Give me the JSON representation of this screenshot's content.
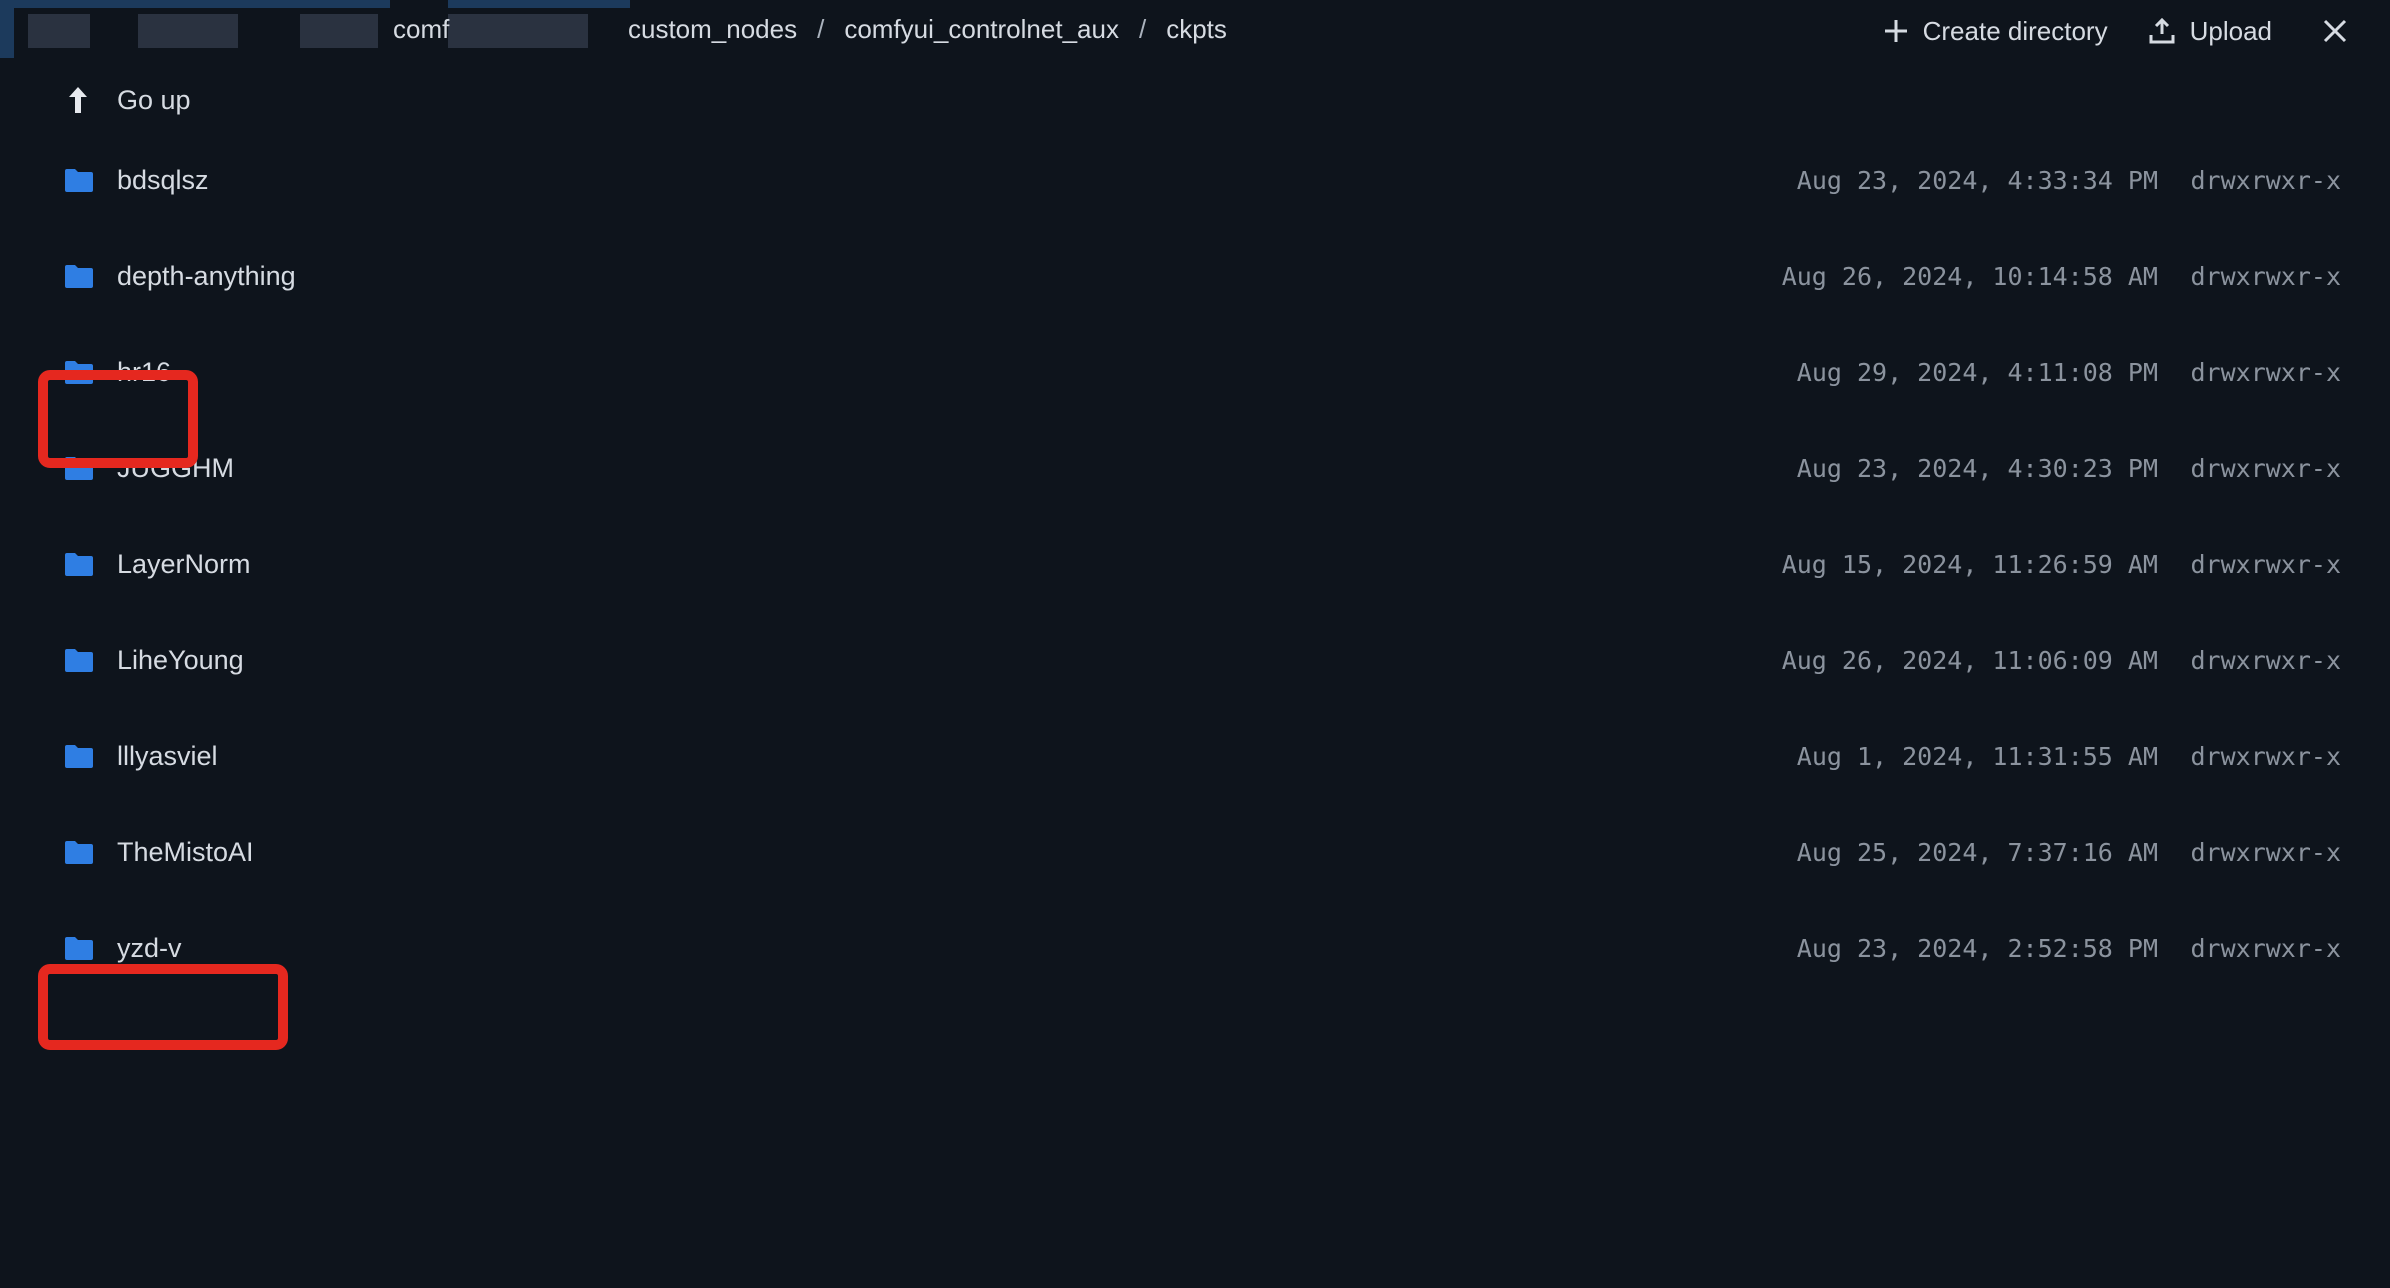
{
  "breadcrumb": {
    "partial_first": "comf",
    "items": [
      "custom_nodes",
      "comfyui_controlnet_aux",
      "ckpts"
    ],
    "separator": "/"
  },
  "actions": {
    "create_directory": "Create directory",
    "upload": "Upload"
  },
  "go_up": {
    "label": "Go up",
    "icon": "arrow-up-icon"
  },
  "folders": [
    {
      "name": "bdsqlsz",
      "date": "Aug 23, 2024, 4:33:34 PM",
      "perm": "drwxrwxr-x"
    },
    {
      "name": "depth-anything",
      "date": "Aug 26, 2024, 10:14:58 AM",
      "perm": "drwxrwxr-x"
    },
    {
      "name": "hr16",
      "date": "Aug 29, 2024, 4:11:08 PM",
      "perm": "drwxrwxr-x"
    },
    {
      "name": "JUGGHM",
      "date": "Aug 23, 2024, 4:30:23 PM",
      "perm": "drwxrwxr-x"
    },
    {
      "name": "LayerNorm",
      "date": "Aug 15, 2024, 11:26:59 AM",
      "perm": "drwxrwxr-x"
    },
    {
      "name": "LiheYoung",
      "date": "Aug 26, 2024, 11:06:09 AM",
      "perm": "drwxrwxr-x"
    },
    {
      "name": "lllyasviel",
      "date": "Aug 1, 2024, 11:31:55 AM",
      "perm": "drwxrwxr-x"
    },
    {
      "name": "TheMistoAI",
      "date": "Aug 25, 2024, 7:37:16 AM",
      "perm": "drwxrwxr-x"
    },
    {
      "name": "yzd-v",
      "date": "Aug 23, 2024, 2:52:58 PM",
      "perm": "drwxrwxr-x"
    }
  ],
  "colors": {
    "background": "#0e141c",
    "folder_icon": "#2f7ee3",
    "highlight": "#e5281f",
    "muted_text": "#8b939e"
  }
}
